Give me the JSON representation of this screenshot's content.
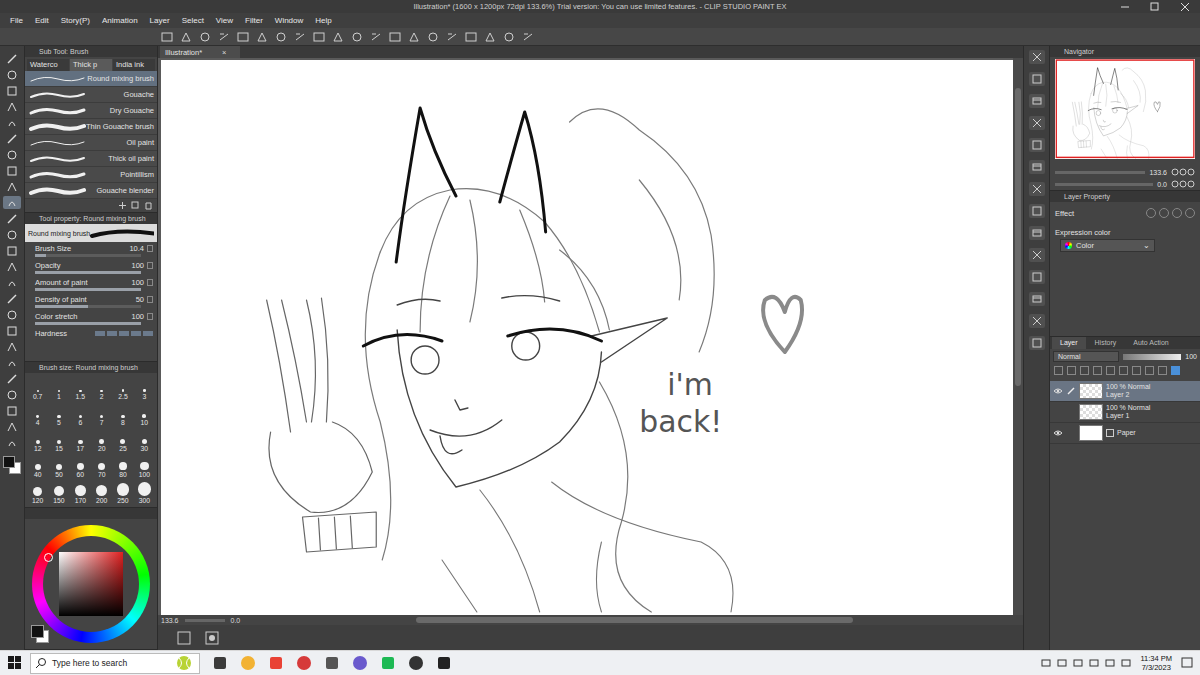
{
  "window": {
    "title": "Illustration* (1600 x 1200px 72dpi 133.6%)  Trial version: You can use limited features. - CLIP STUDIO PAINT EX"
  },
  "menu": [
    "File",
    "Edit",
    "Story(P)",
    "Animation",
    "Layer",
    "Select",
    "View",
    "Filter",
    "Window",
    "Help"
  ],
  "tools": [
    {
      "selected": false
    },
    {
      "selected": false
    },
    {
      "selected": false
    },
    {
      "selected": false
    },
    {
      "selected": false
    },
    {
      "selected": false
    },
    {
      "selected": false
    },
    {
      "selected": false
    },
    {
      "selected": false
    },
    {
      "selected": true
    },
    {
      "selected": false
    },
    {
      "selected": false
    },
    {
      "selected": false
    },
    {
      "selected": false
    },
    {
      "selected": false
    },
    {
      "selected": false
    },
    {
      "selected": false
    },
    {
      "selected": false
    },
    {
      "selected": false
    },
    {
      "selected": false
    },
    {
      "selected": false
    },
    {
      "selected": false
    },
    {
      "selected": false
    },
    {
      "selected": false
    },
    {
      "selected": false
    }
  ],
  "color_chips": [
    {
      "color": "#111111",
      "selected": true
    },
    {
      "color": "#ffffff",
      "selected": false
    }
  ],
  "sub_tool": {
    "title": "Sub Tool: Brush",
    "tabs": [
      {
        "label": "Waterco",
        "selected": false
      },
      {
        "label": "Thick p",
        "selected": true
      },
      {
        "label": "India ink",
        "selected": false
      }
    ],
    "items": [
      {
        "label": "Round mixing brush",
        "selected": true
      },
      {
        "label": "Gouache",
        "selected": false
      },
      {
        "label": "Dry Gouache",
        "selected": false
      },
      {
        "label": "Thin Gouache brush",
        "selected": false
      },
      {
        "label": "Oil paint",
        "selected": false
      },
      {
        "label": "Thick oil paint",
        "selected": false
      },
      {
        "label": "Pointillism",
        "selected": false
      },
      {
        "label": "Gouache blender",
        "selected": false
      }
    ]
  },
  "tool_property": {
    "title": "Tool property: Round mixing brush",
    "preset": "Round mixing brush",
    "properties": [
      {
        "label": "Brush Size",
        "value": "10.4",
        "level": 0.1
      },
      {
        "label": "Opacity",
        "value": "100",
        "level": 1
      },
      {
        "label": "Amount of paint",
        "value": "100",
        "level": 1
      },
      {
        "label": "Density of paint",
        "value": "50",
        "level": 0.5
      },
      {
        "label": "Color stretch",
        "value": "100",
        "level": 1
      }
    ],
    "hardness_label": "Hardness"
  },
  "brush_size": {
    "title": "Brush size: Round mixing brush",
    "sizes": [
      "0.7",
      "1",
      "1.5",
      "2",
      "2.5",
      "3",
      "4",
      "5",
      "6",
      "7",
      "8",
      "10",
      "12",
      "15",
      "17",
      "20",
      "25",
      "30",
      "40",
      "50",
      "60",
      "70",
      "80",
      "100",
      "120",
      "150",
      "170",
      "200",
      "250",
      "300"
    ]
  },
  "document_tab": {
    "label": "Illustration*",
    "close": "×"
  },
  "canvas": {
    "caption": [
      "i'm",
      "back!"
    ],
    "zoom": "133.6",
    "angle": "0.0"
  },
  "navigator": {
    "title": "Navigator",
    "zoom": "133.6",
    "angle": "0.0"
  },
  "layer_property": {
    "title": "Layer Property",
    "effect_label": "Effect",
    "expression_label": "Expression color",
    "expression_value": "Color"
  },
  "layers_panel": {
    "tabs": [
      {
        "label": "Layer",
        "selected": true
      },
      {
        "label": "History",
        "selected": false
      },
      {
        "label": "Auto Action",
        "selected": false
      }
    ],
    "blend_mode": "Normal",
    "opacity": "100",
    "layers": [
      {
        "kind": "raster",
        "mode": "100 % Normal",
        "name": "Layer 2",
        "visible": true,
        "selected": true
      },
      {
        "kind": "raster",
        "mode": "100 % Normal",
        "name": "Layer 1",
        "visible": false,
        "selected": false
      },
      {
        "kind": "paper",
        "name": "Paper",
        "visible": true,
        "selected": false
      }
    ]
  },
  "taskbar": {
    "search_placeholder": "Type here to search",
    "time": "11:34 PM",
    "date": "7/3/2023"
  }
}
